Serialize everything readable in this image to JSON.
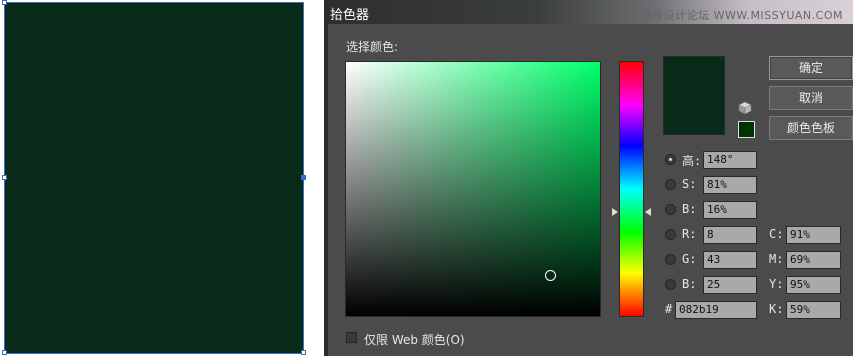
{
  "dialog": {
    "title": "拾色器",
    "watermark": "思缘设计论坛 WWW.MISSYUAN.COM",
    "select_label": "选择颜色:",
    "buttons": {
      "ok": "确定",
      "cancel": "取消",
      "swatches": "颜色色板"
    },
    "current_color": "#082b19",
    "websafe_color": "#003300",
    "fields": {
      "hsb": [
        {
          "label": "高:",
          "value": "148°",
          "selected": true
        },
        {
          "label": "S:",
          "value": "81%"
        },
        {
          "label": "B:",
          "value": "16%"
        }
      ],
      "rgb": [
        {
          "label": "R:",
          "value": "8"
        },
        {
          "label": "G:",
          "value": "43"
        },
        {
          "label": "B:",
          "value": "25"
        }
      ],
      "cmyk": [
        {
          "label": "C:",
          "value": "91%"
        },
        {
          "label": "M:",
          "value": "69%"
        },
        {
          "label": "Y:",
          "value": "95%"
        },
        {
          "label": "K:",
          "value": "59%"
        }
      ],
      "hex_label": "#",
      "hex_value": "082b19"
    },
    "web_only_label": "仅限 Web 颜色(O)",
    "web_only_checked": false
  },
  "canvas": {
    "fill_color": "#082b19"
  }
}
